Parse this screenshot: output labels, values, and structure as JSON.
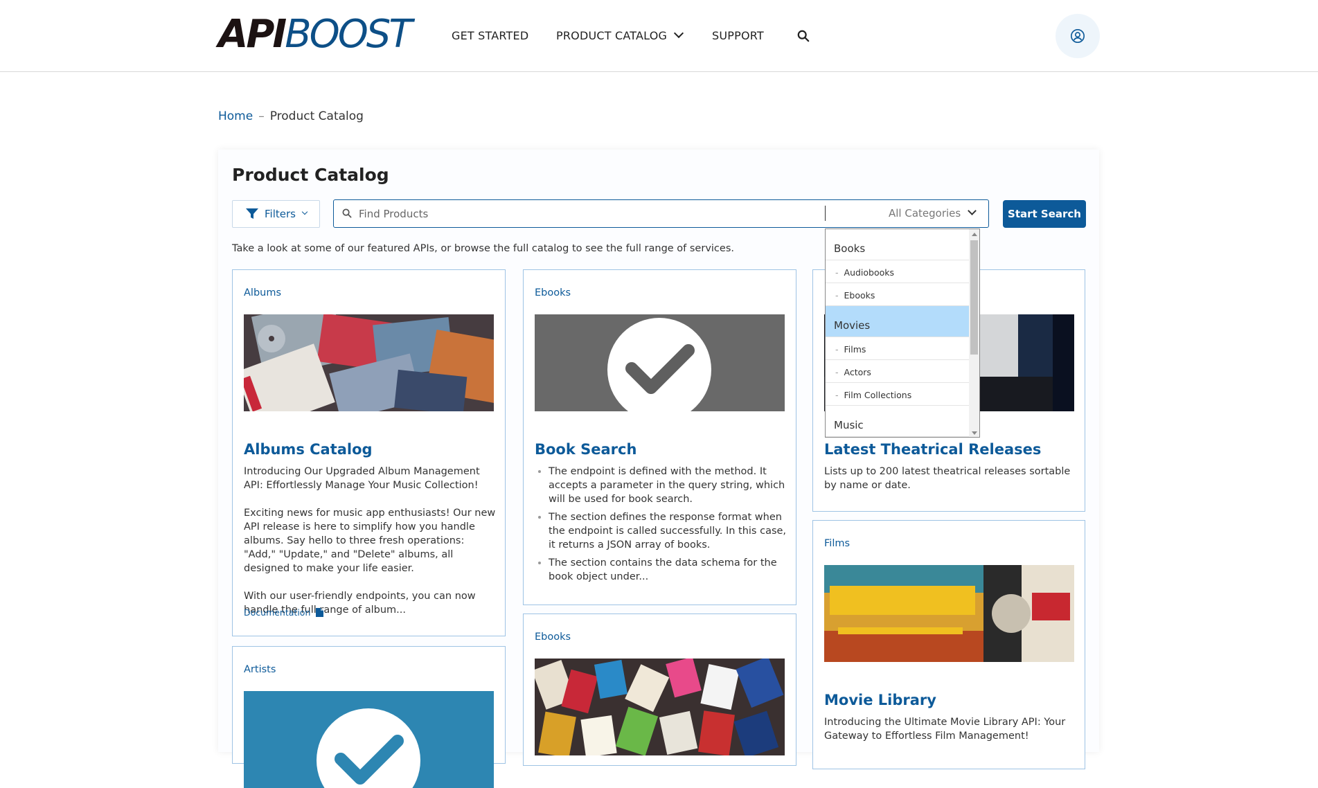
{
  "header": {
    "logo": {
      "part1": "API",
      "part2": "BOOST"
    },
    "nav": [
      "GET STARTED",
      "PRODUCT CATALOG",
      "SUPPORT"
    ]
  },
  "breadcrumb": {
    "home": "Home",
    "current": "Product Catalog"
  },
  "page": {
    "title": "Product Catalog",
    "filters_label": "Filters",
    "search_placeholder": "Find Products",
    "category_selected": "All Categories",
    "start_search_label": "Start Search",
    "intro": "Take a look at some of our featured APIs, or browse the full catalog to see the full range of services."
  },
  "dropdown": {
    "items": [
      "Books",
      "Audiobooks",
      "Ebooks",
      "Movies",
      "Films",
      "Actors",
      "Film Collections",
      "Music"
    ],
    "selected": "Movies"
  },
  "cards": {
    "albums": {
      "category": "Albums",
      "title": "Albums Catalog",
      "p1": "Introducing Our Upgraded Album Management API: Effortlessly Manage Your Music Collection!",
      "p2": "Exciting news for music app enthusiasts! Our new API release is here to simplify how you handle albums. Say hello to three fresh operations: \"Add,\" \"Update,\" and \"Delete\" albums, all designed to make your life easier.",
      "p3": "With our user-friendly endpoints, you can now handle the full range of album...",
      "doc_link": "Documentation"
    },
    "book_search": {
      "category": "Ebooks",
      "title": "Book Search",
      "bullets": [
        "The endpoint is defined with the method. It accepts a parameter in the query string, which will be used for book search.",
        "The section defines the response format when the endpoint is called successfully. In this case, it returns a JSON array of books.",
        "The section contains the data schema for the book object under..."
      ]
    },
    "theatrical": {
      "title": "Latest Theatrical Releases",
      "body": "Lists up to 200 latest theatrical releases sortable by name or date."
    },
    "artists": {
      "category": "Artists"
    },
    "ebooks2": {
      "category": "Ebooks"
    },
    "movie_library": {
      "category": "Films",
      "title": "Movie Library",
      "body": "Introducing the Ultimate Movie Library API: Your Gateway to Effortless Film Management!"
    }
  },
  "colors": {
    "brand_blue": "#0d5a99",
    "dropdown_highlight": "#b3dcfb",
    "card_border": "#9ec3e4"
  }
}
